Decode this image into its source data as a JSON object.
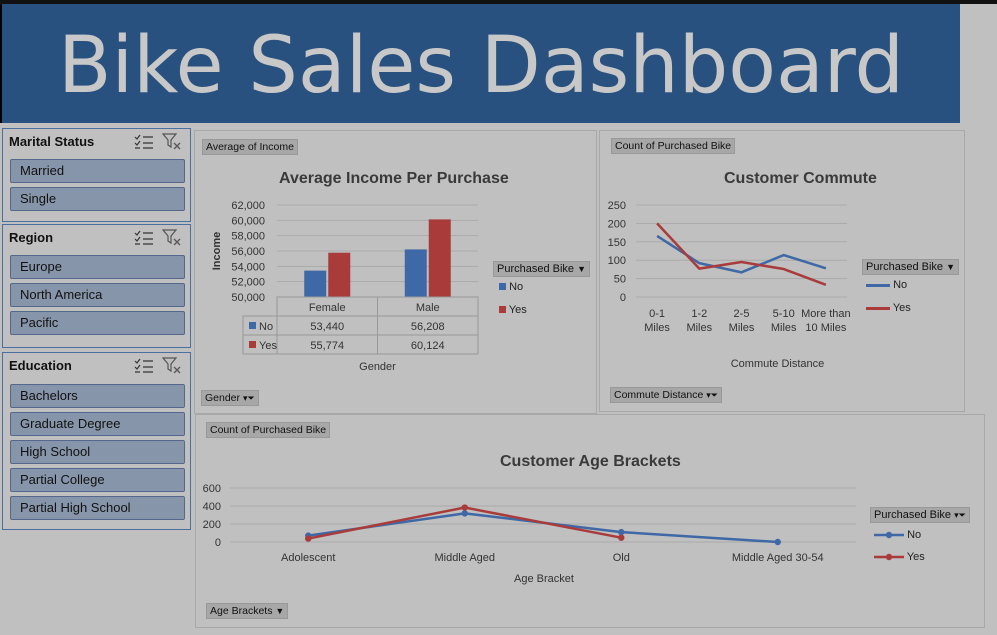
{
  "dashboard": {
    "title": "Bike Sales Dashboard"
  },
  "slicers": {
    "marital": {
      "title": "Marital Status",
      "items": [
        "Married",
        "Single"
      ]
    },
    "region": {
      "title": "Region",
      "items": [
        "Europe",
        "North America",
        "Pacific"
      ]
    },
    "education": {
      "title": "Education",
      "items": [
        "Bachelors",
        "Graduate Degree",
        "High School",
        "Partial College",
        "Partial High School"
      ]
    }
  },
  "income_chart": {
    "value_field": "Average of Income",
    "axis_field": "Gender",
    "legend_field": "Purchased Bike",
    "legend": [
      "No",
      "Yes"
    ]
  },
  "commute_chart": {
    "value_field": "Count of Purchased Bike",
    "axis_field": "Commute Distance",
    "legend_field": "Purchased Bike",
    "legend": [
      "No",
      "Yes"
    ]
  },
  "age_chart": {
    "value_field": "Count of Purchased Bike",
    "axis_field": "Age Brackets",
    "legend_field": "Purchased Bike",
    "legend": [
      "No",
      "Yes"
    ]
  },
  "colors": {
    "no": "#3f68a6",
    "yes": "#a93b3b",
    "banner": "#29517f"
  },
  "chart_data": [
    {
      "type": "bar",
      "title": "Average Income Per Purchase",
      "xlabel": "Gender",
      "ylabel": "Income",
      "categories": [
        "Female",
        "Male"
      ],
      "series": [
        {
          "name": "No",
          "values": [
            53440,
            56208
          ]
        },
        {
          "name": "Yes",
          "values": [
            55774,
            60124
          ]
        }
      ],
      "table": [
        [
          "53,440",
          "56,208"
        ],
        [
          "55,774",
          "60,124"
        ]
      ],
      "yticks": [
        "50,000",
        "52,000",
        "54,000",
        "56,000",
        "58,000",
        "60,000",
        "62,000"
      ],
      "ylim": [
        50000,
        62000
      ],
      "grid": true,
      "legend_position": "right"
    },
    {
      "type": "line",
      "title": "Customer Commute",
      "xlabel": "Commute Distance",
      "ylabel": "",
      "categories": [
        "0-1 Miles",
        "1-2 Miles",
        "2-5 Miles",
        "5-10 Miles",
        "More than 10 Miles"
      ],
      "series": [
        {
          "name": "No",
          "values": [
            166,
            92,
            67,
            114,
            78
          ]
        },
        {
          "name": "Yes",
          "values": [
            200,
            77,
            95,
            76,
            33
          ]
        }
      ],
      "yticks": [
        "0",
        "50",
        "100",
        "150",
        "200",
        "250"
      ],
      "ylim": [
        0,
        250
      ],
      "grid": true,
      "legend_position": "right"
    },
    {
      "type": "line",
      "title": "Customer Age Brackets",
      "xlabel": "Age Bracket",
      "ylabel": "",
      "categories": [
        "Adolescent",
        "Middle Aged",
        "Old",
        "Middle Aged 30-54"
      ],
      "series": [
        {
          "name": "No",
          "values": [
            71,
            318,
            110,
            0
          ]
        },
        {
          "name": "Yes",
          "values": [
            38,
            383,
            48,
            null
          ]
        }
      ],
      "yticks": [
        "0",
        "200",
        "400",
        "600"
      ],
      "ylim": [
        0,
        600
      ],
      "grid": true,
      "legend_position": "right"
    }
  ]
}
